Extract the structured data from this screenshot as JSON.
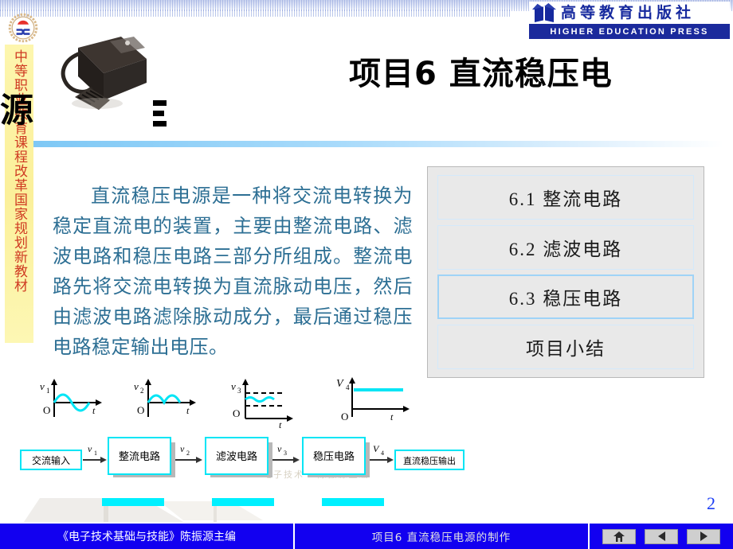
{
  "publisher": {
    "cn_name": "高等教育出版社",
    "en_name": "HIGHER EDUCATION PRESS",
    "emblem_icon": "book-emblem-icon",
    "brand_color": "#1b2a9c"
  },
  "sidebar": {
    "vertical_text": "中等职业教育课程改革国家规划新教材",
    "band_color": "#fbf09a",
    "text_color": "#cf3a22"
  },
  "logo": {
    "name": "school-gear-logo",
    "gear_color": "#e8c89a",
    "sun_color": "#e8312b",
    "mark_color": "#2b3fae"
  },
  "header": {
    "title_line1": "项目6  直流稳压电",
    "title_line2": "源",
    "full_title": "项目6  直流稳压电源的制作",
    "photo_alt": "电源适配器照片",
    "marks": [
      "mark-1",
      "mark-2",
      "mark-3"
    ],
    "rule_color": "#7ec8f5"
  },
  "body": {
    "paragraph": "直流稳压电源是一种将交流电转换为稳定直流电的装置，主要由整流电路、滤波电路和稳压电路三部分所组成。整流电路先将交流电转换为直流脉动电压，然后由滤波电路滤除脉动成分，最后通过稳压电路稳定输出电压。",
    "text_color": "#2d6f94"
  },
  "agenda": {
    "panel_bg": "#e9e9e9",
    "items": [
      {
        "label": "6.1  整流电路",
        "active": false
      },
      {
        "label": "6.2  滤波电路",
        "active": false
      },
      {
        "label": "6.3  稳压电路",
        "active": true
      },
      {
        "label": "项目小结",
        "active": false
      }
    ]
  },
  "diagram": {
    "wave_color": "#00e5f5",
    "waveforms": [
      {
        "ylabel": "v",
        "ysub": "1",
        "xlabel": "t",
        "origin": "O",
        "shape": "sine"
      },
      {
        "ylabel": "v",
        "ysub": "2",
        "xlabel": "t",
        "origin": "O",
        "shape": "rectified-sine"
      },
      {
        "ylabel": "v",
        "ysub": "3",
        "xlabel": "t",
        "origin": "O",
        "shape": "ripple-dc"
      },
      {
        "ylabel": "V",
        "ysub": "4",
        "xlabel": "t",
        "origin": "O",
        "shape": "flat-dc"
      }
    ],
    "blocks": [
      {
        "label": "交流输入",
        "style": "plain"
      },
      {
        "label": "整流电路",
        "style": "shadow"
      },
      {
        "label": "滤波电路",
        "style": "shadow"
      },
      {
        "label": "稳压电路",
        "style": "shadow"
      },
      {
        "label": "直流稳压输出",
        "style": "plain"
      }
    ],
    "signals": [
      {
        "label": "v",
        "sub": "1"
      },
      {
        "label": "v",
        "sub": "2"
      },
      {
        "label": "v",
        "sub": "3"
      },
      {
        "label": "V",
        "sub": "4"
      }
    ],
    "watermark": "电子技术 · 陈振源主编"
  },
  "footer": {
    "book_title": "《电子技术基础与技能》陈振源主编",
    "project_title": "项目6    直流稳压电源的制作",
    "page_number": "2",
    "nav": [
      {
        "name": "home-button",
        "icon": "home-icon"
      },
      {
        "name": "previous-button",
        "icon": "triangle-left-icon"
      },
      {
        "name": "next-button",
        "icon": "triangle-right-icon"
      }
    ],
    "bar_color": "#1200f0"
  }
}
